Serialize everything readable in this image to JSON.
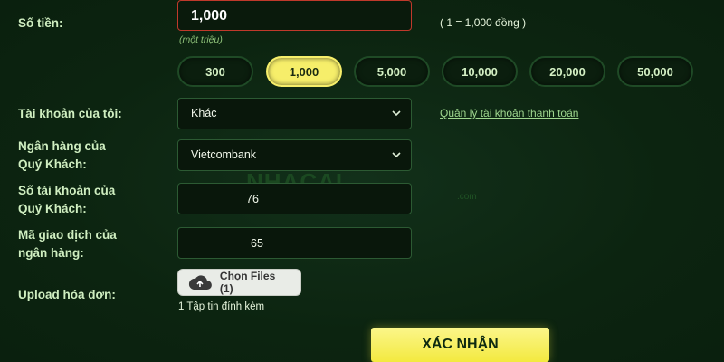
{
  "amount": {
    "label": "Số tiền:",
    "value": "1,000",
    "hint": "(một triệu)",
    "rate": "( 1 = 1,000 đồng )"
  },
  "quick_amounts": [
    {
      "label": "300",
      "selected": false
    },
    {
      "label": "1,000",
      "selected": true
    },
    {
      "label": "5,000",
      "selected": false
    },
    {
      "label": "10,000",
      "selected": false
    },
    {
      "label": "20,000",
      "selected": false
    },
    {
      "label": "50,000",
      "selected": false
    }
  ],
  "my_account": {
    "label": "Tài khoản của tôi:",
    "selected": "Khác",
    "manage_link": "Quản lý tài khoản thanh toán"
  },
  "customer_bank": {
    "label_line1": "Ngân hàng của",
    "label_line2": "Quý Khách:",
    "selected": "Vietcombank"
  },
  "customer_account_number": {
    "label_line1": "Số tài khoản của",
    "label_line2": "Quý Khách:",
    "value": "76"
  },
  "transaction_code": {
    "label_line1": "Mã giao dịch của",
    "label_line2": "ngân hàng:",
    "value": "65"
  },
  "upload": {
    "label": "Upload hóa đơn:",
    "button_label": "Chọn Files (1)",
    "attached_text": "1 Tập tin đính kèm"
  },
  "watermark": {
    "text": "NHACAI",
    "sub": ".com"
  },
  "confirm_button": "XÁC NHẬN",
  "colors": {
    "background": "#0c2410",
    "accent": "#f6ee6a",
    "input_error_border": "#c0392b"
  }
}
